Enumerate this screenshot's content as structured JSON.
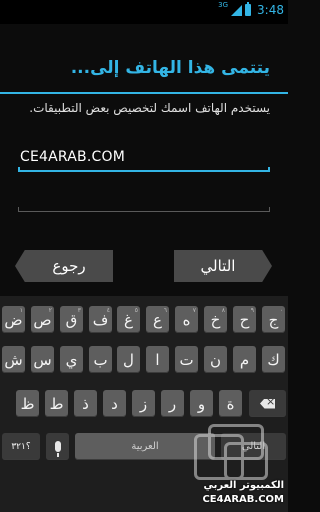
{
  "status_bar": {
    "network": "3G",
    "time": "3:48"
  },
  "setup": {
    "title": "يتتمى هذا الهاتف إلى...",
    "description": "يستخدم الهاتف اسمك لتخصيص بعض التطبيقات.",
    "name_value": "CE4ARAB.COM",
    "second_value": ""
  },
  "nav": {
    "back_label": "رجوع",
    "next_label": "التالي"
  },
  "keyboard": {
    "row1": [
      {
        "label": "ض",
        "hint": "١"
      },
      {
        "label": "ص",
        "hint": "٢"
      },
      {
        "label": "ق",
        "hint": "٣"
      },
      {
        "label": "ف",
        "hint": "٤"
      },
      {
        "label": "غ",
        "hint": "٥"
      },
      {
        "label": "ع",
        "hint": "٦"
      },
      {
        "label": "ه",
        "hint": "٧"
      },
      {
        "label": "خ",
        "hint": "٨"
      },
      {
        "label": "ح",
        "hint": "٩"
      },
      {
        "label": "ج",
        "hint": "٠"
      }
    ],
    "row2": [
      "ش",
      "س",
      "ي",
      "ب",
      "ل",
      "ا",
      "ت",
      "ن",
      "م",
      "ك"
    ],
    "row3": [
      "ظ",
      "ط",
      "ذ",
      "د",
      "ز",
      "ر",
      "و",
      "ة",
      "ث"
    ],
    "symbols_label": "؟٣٢١",
    "space_label": "العربية",
    "enter_label": "التالي"
  },
  "watermark": {
    "line1": "الكمبيوتر العربي",
    "line2": "CE4ARAB.COM"
  },
  "colors": {
    "accent": "#33b5e5",
    "background": "#0c0c0c",
    "key": "#5e5e5e",
    "button": "#4a4a4a"
  }
}
